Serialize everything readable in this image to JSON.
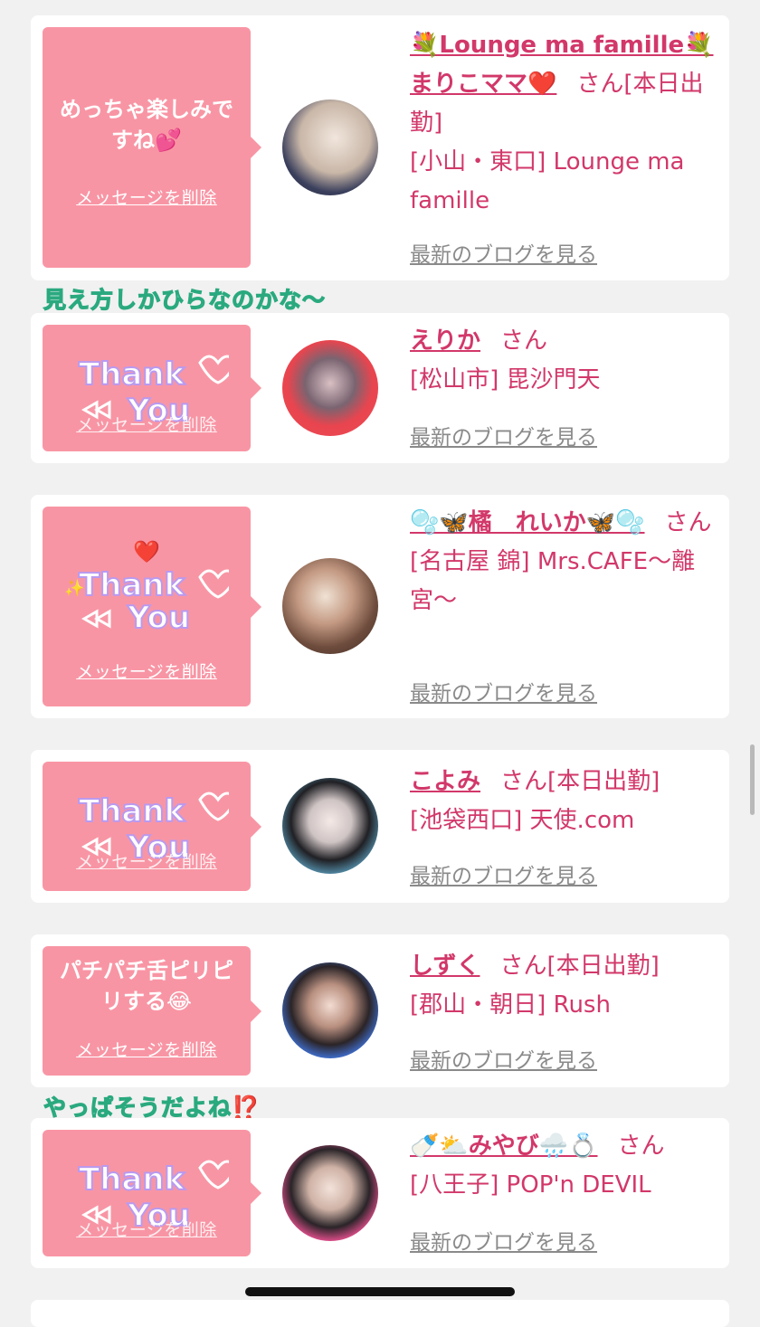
{
  "overlays": {
    "top_caption": "見え方しかひらなのかな〜",
    "bottom_caption": "やっぱそうだよね⁉️"
  },
  "colors": {
    "pink_bubble": "#f895a4",
    "name_pink": "#d2386a",
    "caption_green": "#7fe3c2"
  },
  "common": {
    "delete_label": "メッセージを削除",
    "blog_label": "最新のブログを見る",
    "san": "さん"
  },
  "cards": [
    {
      "message": "めっちゃ楽しみですね💕",
      "stamp": "",
      "name": "💐Lounge ma famille💐まりこママ❤️",
      "status": "[本日出勤]",
      "location": "[小山・東口] Lounge ma famille"
    },
    {
      "message": "",
      "stamp": "Thank You",
      "name": "えりか",
      "status": "",
      "location": "[松山市] 毘沙門天"
    },
    {
      "message": "",
      "stamp": "Thank You",
      "name": "🫧🦋橘　れいか🦋🫧",
      "status": "",
      "location": "[名古屋 錦] Mrs.CAFE〜離宮〜"
    },
    {
      "message": "",
      "stamp": "Thank You",
      "name": "こよみ",
      "status": "[本日出勤]",
      "location": "[池袋西口] 天使.com"
    },
    {
      "message": "パチパチ舌ピリピリする😂",
      "stamp": "",
      "name": "しずく",
      "status": "[本日出勤]",
      "location": "[郡山・朝日] Rush"
    },
    {
      "message": "",
      "stamp": "Thank You",
      "name": "🍼⛅みやび🌧️💍",
      "status": "",
      "location": "[八王子] POP'n DEVIL"
    }
  ]
}
